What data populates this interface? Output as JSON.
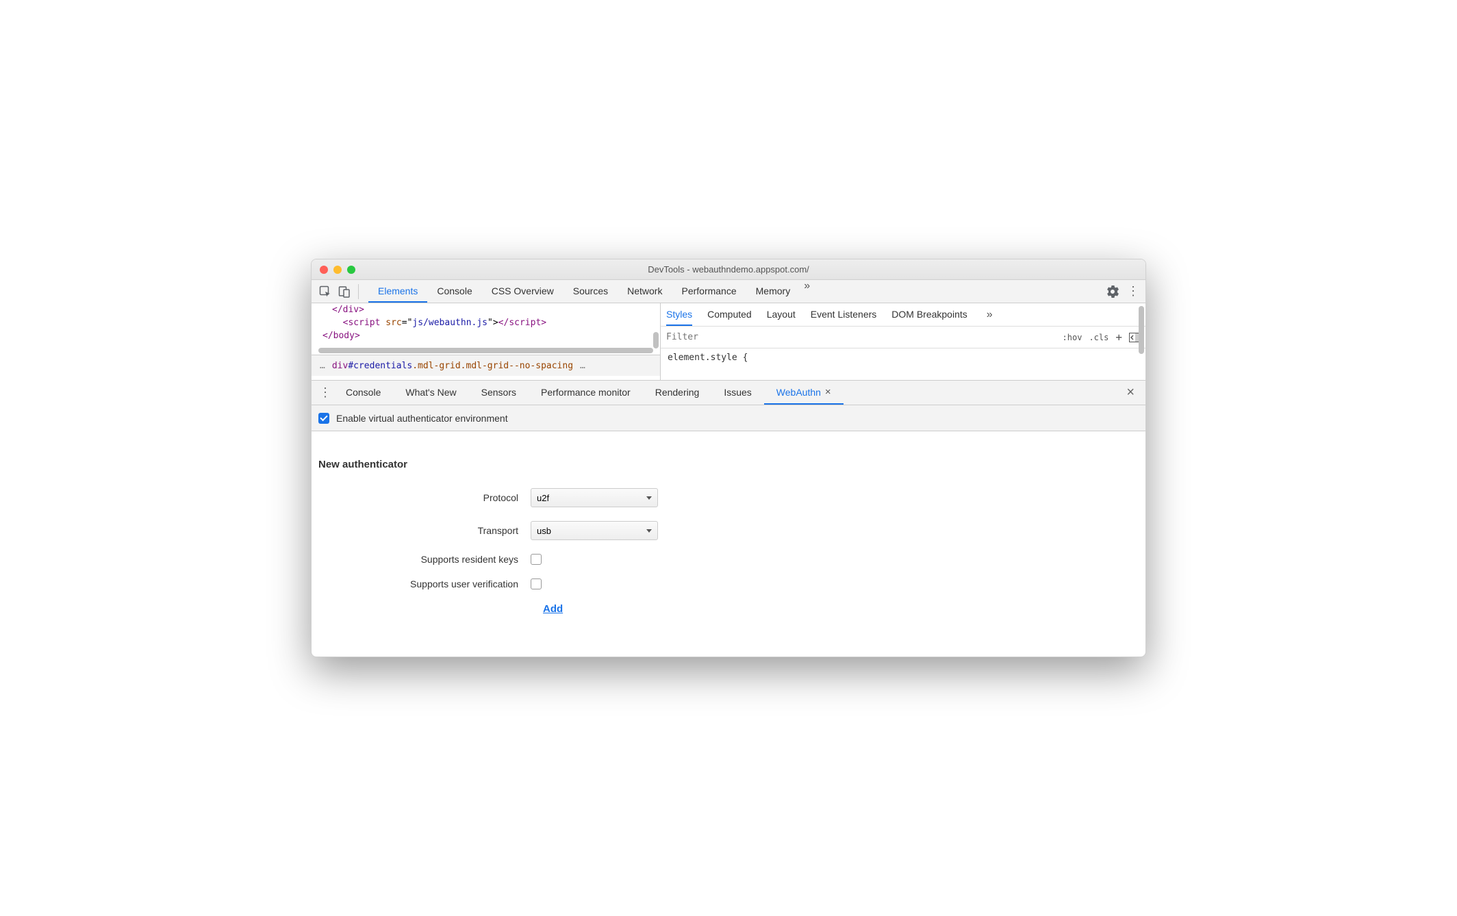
{
  "window": {
    "title": "DevTools - webauthndemo.appspot.com/"
  },
  "mainTabs": {
    "items": [
      "Elements",
      "Console",
      "CSS Overview",
      "Sources",
      "Network",
      "Performance",
      "Memory"
    ],
    "activeIndex": 0,
    "overflow": "»"
  },
  "code": {
    "line1a": "</",
    "line1b": "div",
    "line1c": ">",
    "line2a": "<",
    "line2b": "script ",
    "line2c": "src",
    "line2d": "=\"",
    "line2e": "js/webauthn.js",
    "line2f": "\">",
    "line2g": "</",
    "line2h": "script",
    "line2i": ">",
    "line3a": "</",
    "line3b": "body",
    "line3c": ">"
  },
  "stylesTabs": {
    "items": [
      "Styles",
      "Computed",
      "Layout",
      "Event Listeners",
      "DOM Breakpoints"
    ],
    "activeIndex": 0,
    "overflow": "»"
  },
  "filter": {
    "placeholder": "Filter",
    "hov": ":hov",
    "cls": ".cls",
    "plus": "+"
  },
  "stylesBody": "element.style {",
  "breadcrumb": {
    "ellipsisLeft": "…",
    "el": "div",
    "id": "#credentials",
    "cls": ".mdl-grid.mdl-grid--no-spacing",
    "ellipsisRight": "…"
  },
  "drawerTabs": {
    "items": [
      "Console",
      "What's New",
      "Sensors",
      "Performance monitor",
      "Rendering",
      "Issues",
      "WebAuthn"
    ],
    "activeIndex": 6
  },
  "enable": {
    "label": "Enable virtual authenticator environment",
    "checked": true
  },
  "form": {
    "title": "New authenticator",
    "protocolLabel": "Protocol",
    "protocolValue": "u2f",
    "transportLabel": "Transport",
    "transportValue": "usb",
    "residentLabel": "Supports resident keys",
    "userVerLabel": "Supports user verification",
    "addLabel": "Add"
  }
}
